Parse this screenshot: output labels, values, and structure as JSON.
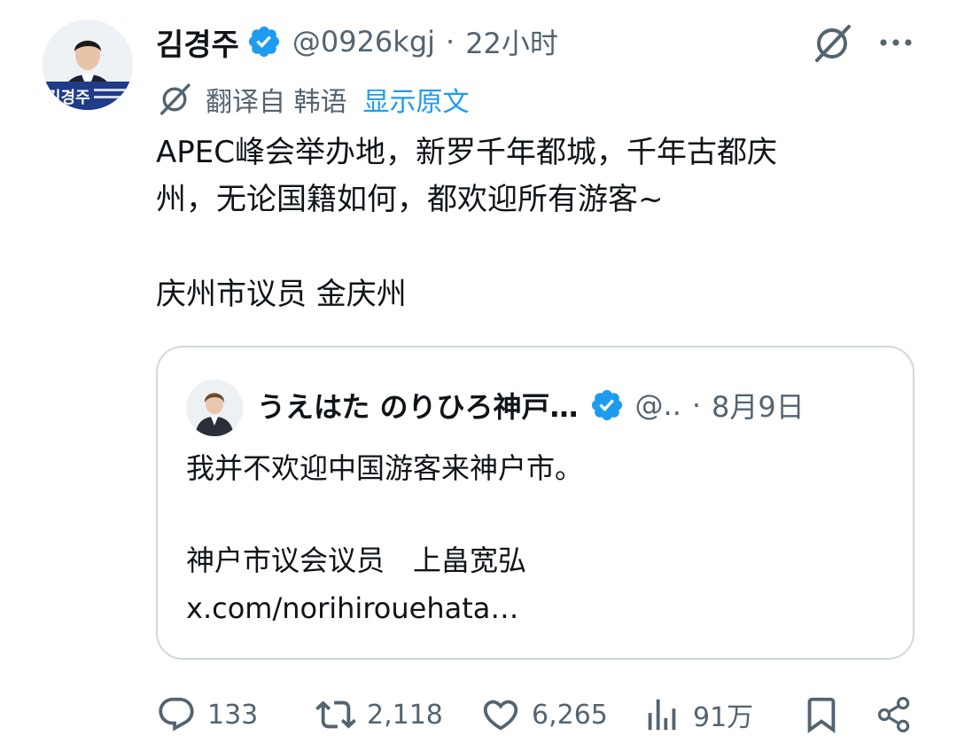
{
  "author": {
    "display_name": "김경주",
    "handle": "@0926kgj",
    "separator": "·",
    "time": "22小时",
    "avatar_banner_name": "김경주"
  },
  "translation": {
    "label": "翻译自 韩语",
    "show_original": "显示原文"
  },
  "tweet": {
    "text_line1": "APEC峰会举办地，新罗千年都城，千年古都庆",
    "text_line2": "州，无论国籍如何，都欢迎所有游客~",
    "signature": "庆州市议员 金庆州"
  },
  "quote": {
    "display_name": "うえはた のりひろ神戸…",
    "handle": "@..",
    "separator": "·",
    "date": "8月9日",
    "text": "我并不欢迎中国游客来神户市。",
    "signature": "神户市议会议员　上畠宽弘",
    "link": "x.com/norihirouehata…"
  },
  "actions": {
    "replies": "133",
    "reposts": "2,118",
    "likes": "6,265",
    "views": "91万"
  },
  "colors": {
    "text_primary": "#0f1419",
    "text_secondary": "#536471",
    "accent": "#1d9bf0",
    "border": "#cfd9de",
    "background": "#ffffff"
  },
  "icons": [
    "grok-icon",
    "more-icon",
    "translate-icon",
    "verified-badge-icon",
    "reply-icon",
    "repost-icon",
    "like-icon",
    "views-icon",
    "bookmark-icon",
    "share-icon"
  ]
}
